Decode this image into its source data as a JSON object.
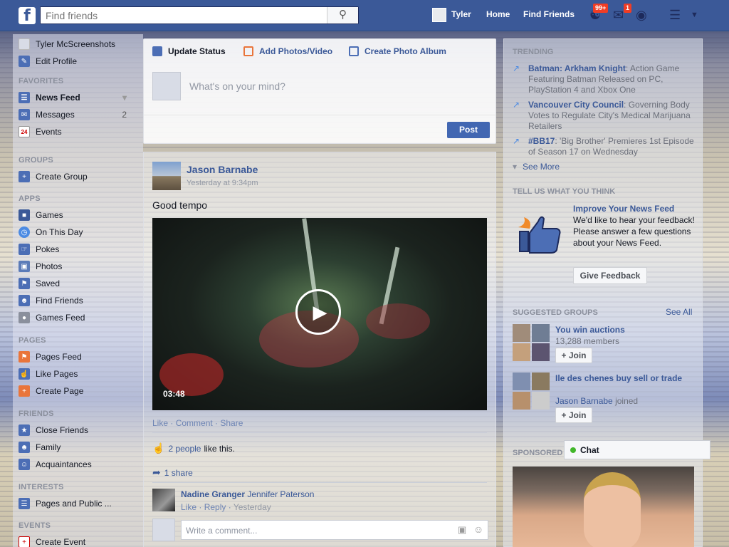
{
  "topbar": {
    "logo": "f",
    "search_placeholder": "Find friends",
    "user_name": "Tyler",
    "nav_home": "Home",
    "nav_find_friends": "Find Friends",
    "friend_requests_badge": "99+",
    "messages_badge": "1",
    "brand_color": "#3b5998"
  },
  "left": {
    "profile_name": "Tyler McScreenshots",
    "edit_profile": "Edit Profile",
    "favorites_title": "FAVORITES",
    "favorites": [
      {
        "label": "News Feed",
        "icon": "news-feed-icon"
      },
      {
        "label": "Messages",
        "count": "2",
        "icon": "messages-icon"
      },
      {
        "label": "Events",
        "icon": "calendar-icon",
        "icon_text": "24"
      }
    ],
    "groups_title": "GROUPS",
    "groups": [
      {
        "label": "Create Group",
        "icon": "plus-icon"
      }
    ],
    "apps_title": "APPS",
    "apps": [
      {
        "label": "Games",
        "icon": "games-icon"
      },
      {
        "label": "On This Day",
        "icon": "clock-icon"
      },
      {
        "label": "Pokes",
        "icon": "poke-icon"
      },
      {
        "label": "Photos",
        "icon": "photos-icon"
      },
      {
        "label": "Saved",
        "icon": "bookmark-icon"
      },
      {
        "label": "Find Friends",
        "icon": "friends-icon"
      },
      {
        "label": "Games Feed",
        "icon": "gamepad-icon"
      }
    ],
    "pages_title": "PAGES",
    "pages": [
      {
        "label": "Pages Feed",
        "icon": "flag-icon"
      },
      {
        "label": "Like Pages",
        "icon": "like-icon"
      },
      {
        "label": "Create Page",
        "icon": "plus-icon"
      }
    ],
    "friends_title": "FRIENDS",
    "friends": [
      {
        "label": "Close Friends",
        "icon": "star-icon"
      },
      {
        "label": "Family",
        "icon": "family-icon"
      },
      {
        "label": "Acquaintances",
        "icon": "acquaintances-icon"
      }
    ],
    "interests_title": "INTERESTS",
    "interests": [
      {
        "label": "Pages and Public ...",
        "icon": "list-icon"
      }
    ],
    "events_title": "EVENTS",
    "events": [
      {
        "label": "Create Event",
        "icon": "plus-icon"
      }
    ]
  },
  "composer": {
    "tab_status": "Update Status",
    "tab_photos": "Add Photos/Video",
    "tab_album": "Create Photo Album",
    "placeholder": "What's on your mind?",
    "post_button": "Post"
  },
  "post": {
    "author": "Jason Barnabe",
    "time": "Yesterday at 9:34pm",
    "text": "Good tempo",
    "video_duration": "03:48",
    "action_like": "Like",
    "action_comment": "Comment",
    "action_share": "Share",
    "likes_link": "2 people",
    "likes_suffix": "like this.",
    "shares": "1 share",
    "comment_author": "Nadine Granger",
    "comment_text": "Jennifer Paterson",
    "comment_like": "Like",
    "comment_reply": "Reply",
    "comment_time": "Yesterday",
    "comment_placeholder": "Write a comment..."
  },
  "right": {
    "trending_title": "TRENDING",
    "trending": [
      {
        "topic": "Batman: Arkham Knight",
        "desc": ": Action Game Featuring Batman Released on PC, PlayStation 4 and Xbox One"
      },
      {
        "topic": "Vancouver City Council",
        "desc": ": Governing Body Votes to Regulate City's Medical Marijuana Retailers"
      },
      {
        "topic": "#BB17",
        "desc": ": 'Big Brother' Premieres 1st Episode of Season 17 on Wednesday"
      }
    ],
    "see_more": "See More",
    "tell_title": "TELL US WHAT YOU THINK",
    "improve_title": "Improve Your News Feed",
    "improve_text": "We'd like to hear your feedback! Please answer a few questions about your News Feed.",
    "feedback_button": "Give Feedback",
    "suggested_title": "SUGGESTED GROUPS",
    "see_all": "See All",
    "groups": [
      {
        "name": "You win auctions",
        "sub": "13,288 members",
        "join": "+ Join"
      },
      {
        "name": "Ile des chenes buy sell or trade",
        "sub_link": "Jason Barnabe",
        "sub": " joined",
        "join": "+ Join"
      }
    ],
    "sponsored_title": "SPONSORED"
  },
  "chat": {
    "label": "Chat"
  }
}
